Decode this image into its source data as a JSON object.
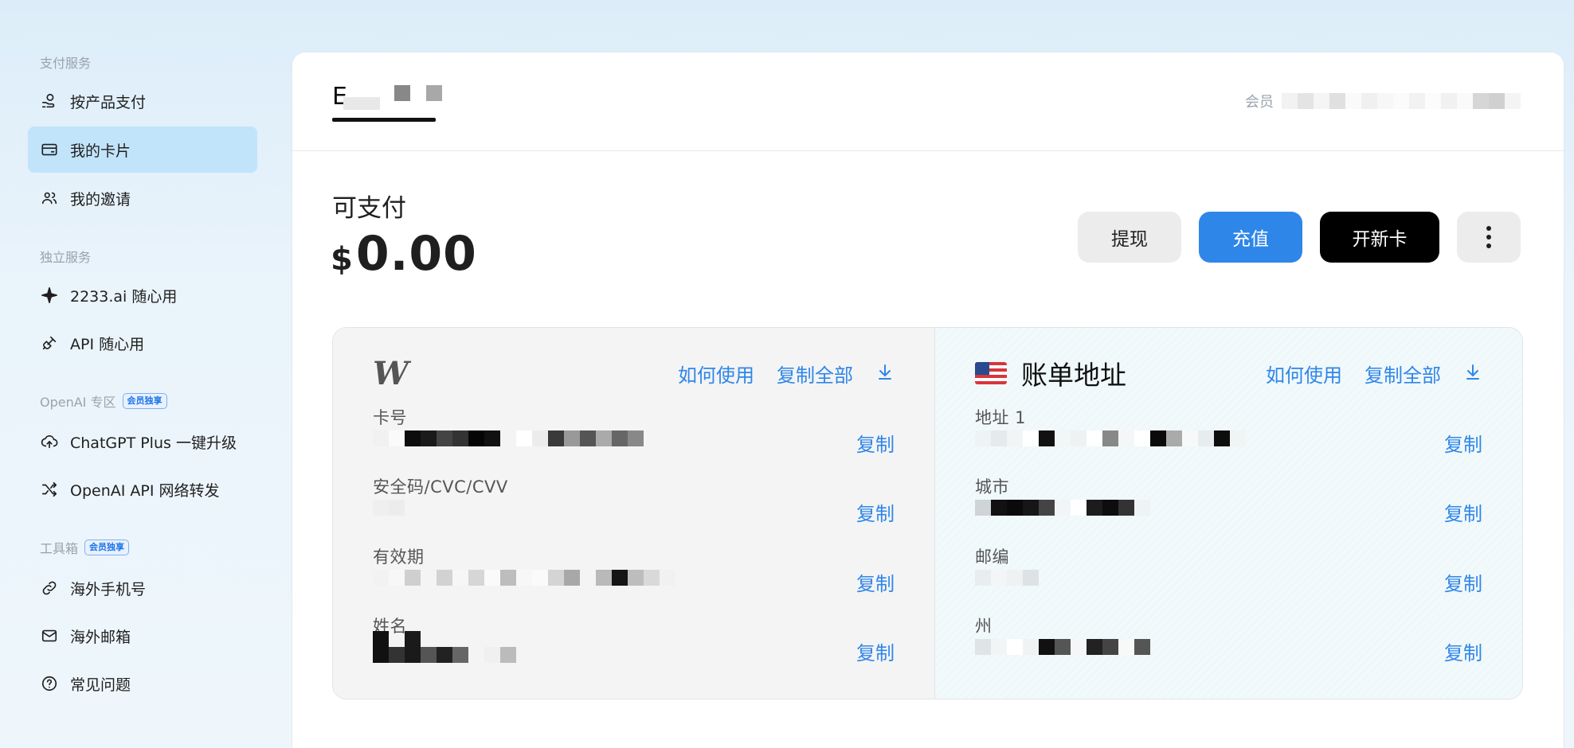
{
  "sidebar": {
    "section_pay": "支付服务",
    "section_independent": "独立服务",
    "section_openai": "OpenAI 专区",
    "section_tools": "工具箱",
    "member_badge": "会员独享",
    "items": [
      {
        "label": "按产品支付",
        "icon": "coin-hand-icon"
      },
      {
        "label": "我的卡片",
        "icon": "card-icon",
        "active": true
      },
      {
        "label": "我的邀请",
        "icon": "users-icon"
      },
      {
        "label": "2233.ai 随心用",
        "icon": "sparkle-icon"
      },
      {
        "label": "API 随心用",
        "icon": "plug-icon"
      },
      {
        "label": "ChatGPT Plus 一键升级",
        "icon": "cloud-upload-icon"
      },
      {
        "label": "OpenAI API 网络转发",
        "icon": "shuffle-icon"
      },
      {
        "label": "海外手机号",
        "icon": "link-icon"
      },
      {
        "label": "海外邮箱",
        "icon": "mail-icon"
      },
      {
        "label": "常见问题",
        "icon": "help-circle-icon"
      }
    ]
  },
  "header": {
    "logo_text": "E",
    "member_label": "会员"
  },
  "balance": {
    "label": "可支付",
    "currency": "$",
    "amount": "0.00"
  },
  "actions": {
    "withdraw": "提现",
    "topup": "充值",
    "new_card": "开新卡"
  },
  "card": {
    "brand": "W",
    "how_to_use": "如何使用",
    "copy_all": "复制全部",
    "copy": "复制",
    "fields": {
      "number": "卡号",
      "cvv": "安全码/CVC/CVV",
      "expiry": "有效期",
      "name": "姓名"
    }
  },
  "billing": {
    "title": "账单地址",
    "how_to_use": "如何使用",
    "copy_all": "复制全部",
    "copy": "复制",
    "fields": {
      "address1": "地址 1",
      "city": "城市",
      "zip": "邮编",
      "state": "州"
    }
  },
  "colors": {
    "accent": "#2f86e9",
    "active_nav": "#c2e4fb",
    "page_bg": "#e4f1fa"
  }
}
